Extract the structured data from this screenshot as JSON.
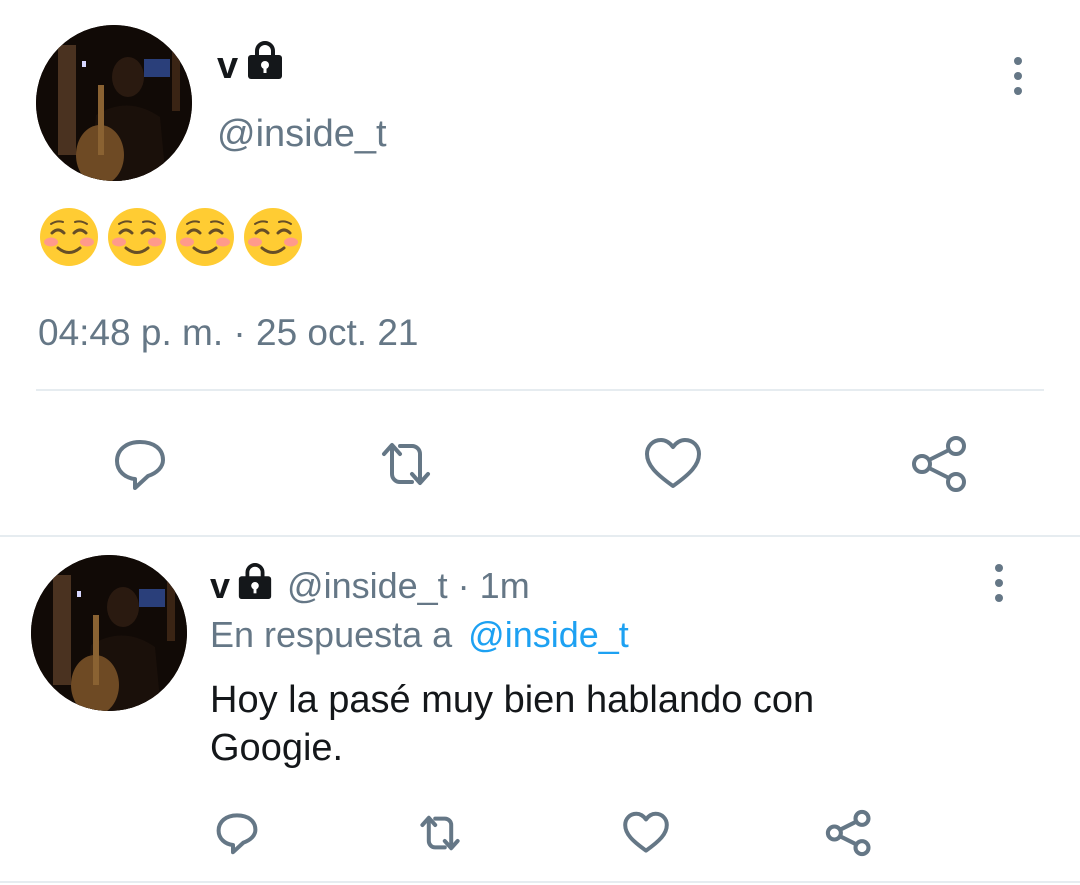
{
  "main_tweet": {
    "display_name": "v",
    "handle": "@inside_t",
    "emojis": [
      "smiling-face-with-smiling-eyes",
      "smiling-face-with-smiling-eyes",
      "smiling-face-with-smiling-eyes",
      "smiling-face-with-smiling-eyes"
    ],
    "timestamp": "04:48 p. m. · 25 oct. 21",
    "actions": [
      "reply-icon",
      "retweet-icon",
      "like-icon",
      "share-icon"
    ]
  },
  "reply_tweet": {
    "display_name": "v",
    "handle": "@inside_t",
    "separator": "·",
    "time_ago": "1m",
    "replying_prefix": "En respuesta a",
    "replying_to": "@inside_t",
    "text_line1": "Hoy la pasé muy bien hablando con",
    "text_line2": "Googie.",
    "actions": [
      "reply-icon",
      "retweet-icon",
      "like-icon",
      "share-icon"
    ]
  },
  "colors": {
    "text": "#14171a",
    "muted": "#657786",
    "link": "#1da1f2",
    "divider": "#e6ecf0",
    "emoji_face": "#ffcc33",
    "emoji_blush": "#ff9a8b"
  }
}
